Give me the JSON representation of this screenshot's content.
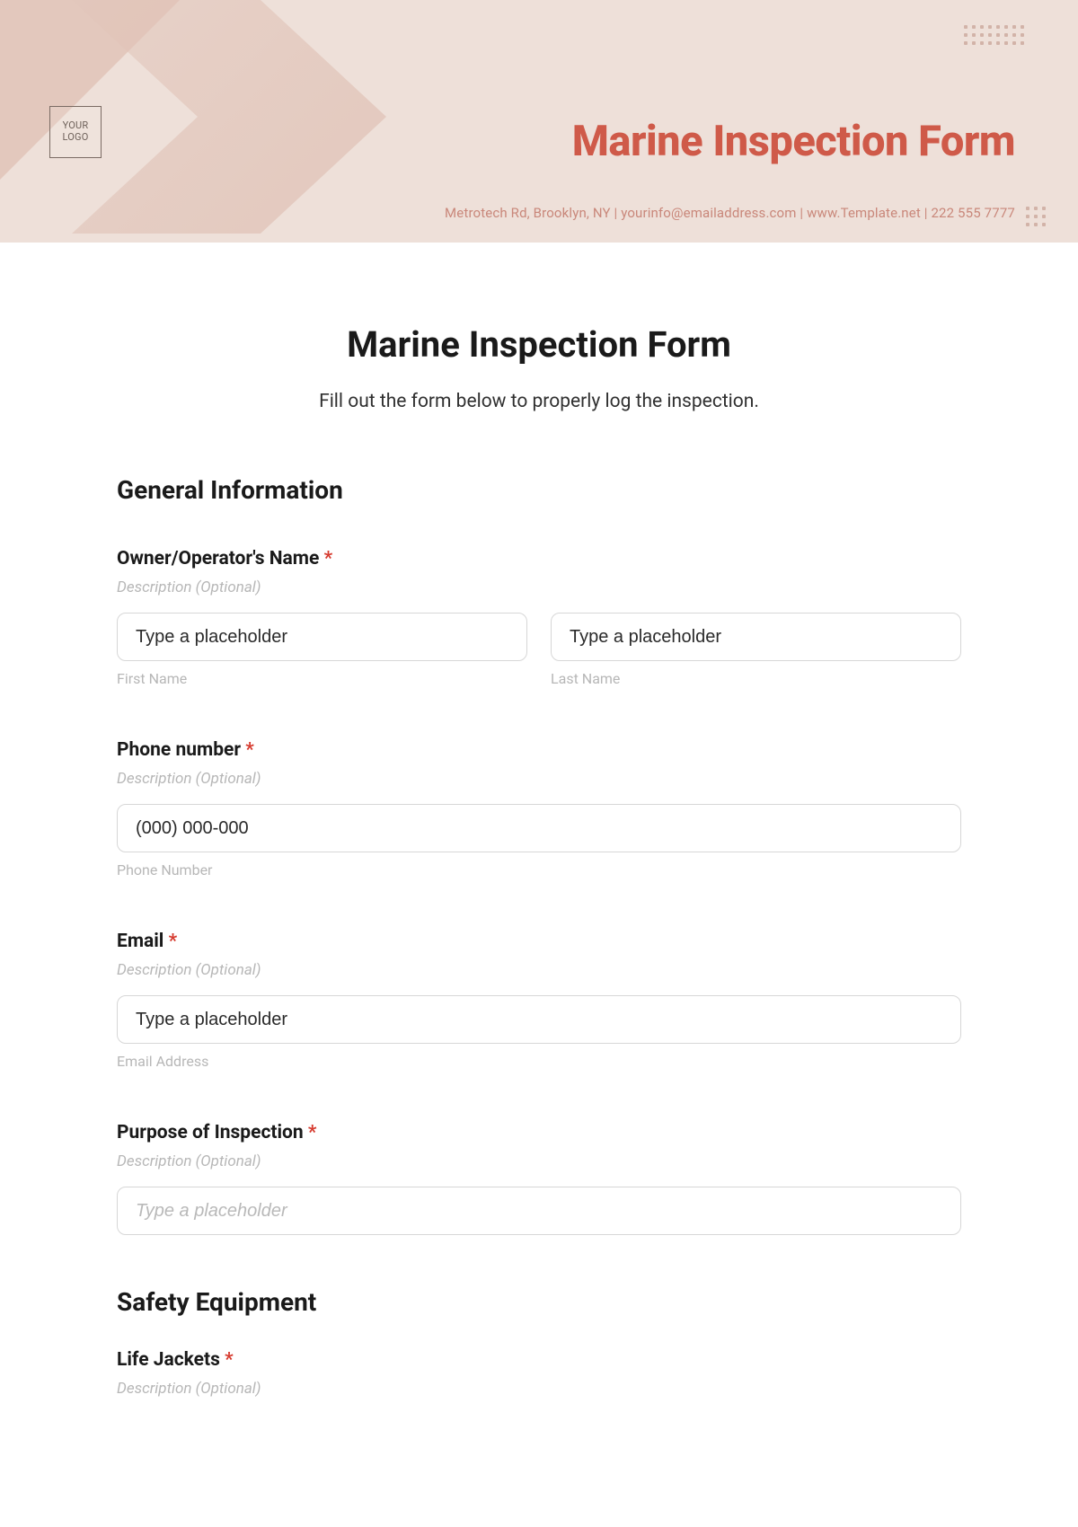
{
  "banner": {
    "logo_text": "YOUR\nLOGO",
    "title": "Marine Inspection Form",
    "meta": "Metrotech Rd, Brooklyn, NY  |  yourinfo@emailaddress.com  |  www.Template.net  |  222 555 7777"
  },
  "form": {
    "title": "Marine Inspection Form",
    "subtitle": "Fill out the form below to properly log the inspection."
  },
  "sections": {
    "general": {
      "heading": "General Information",
      "owner": {
        "label": "Owner/Operator's Name",
        "required": "*",
        "desc": "Description (Optional)",
        "first_value": "Type a placeholder",
        "first_sub": "First Name",
        "last_value": "Type a placeholder",
        "last_sub": "Last Name"
      },
      "phone": {
        "label": "Phone number",
        "required": "*",
        "desc": "Description (Optional)",
        "value": "(000) 000-000",
        "sub": "Phone Number"
      },
      "email": {
        "label": "Email",
        "required": "*",
        "desc": "Description (Optional)",
        "value": "Type a placeholder",
        "sub": "Email Address"
      },
      "purpose": {
        "label": "Purpose of Inspection",
        "required": "*",
        "desc": "Description (Optional)",
        "placeholder": "Type a placeholder"
      }
    },
    "safety": {
      "heading": "Safety Equipment",
      "life_jackets": {
        "label": "Life Jackets",
        "required": "*",
        "desc": "Description (Optional)"
      }
    }
  }
}
